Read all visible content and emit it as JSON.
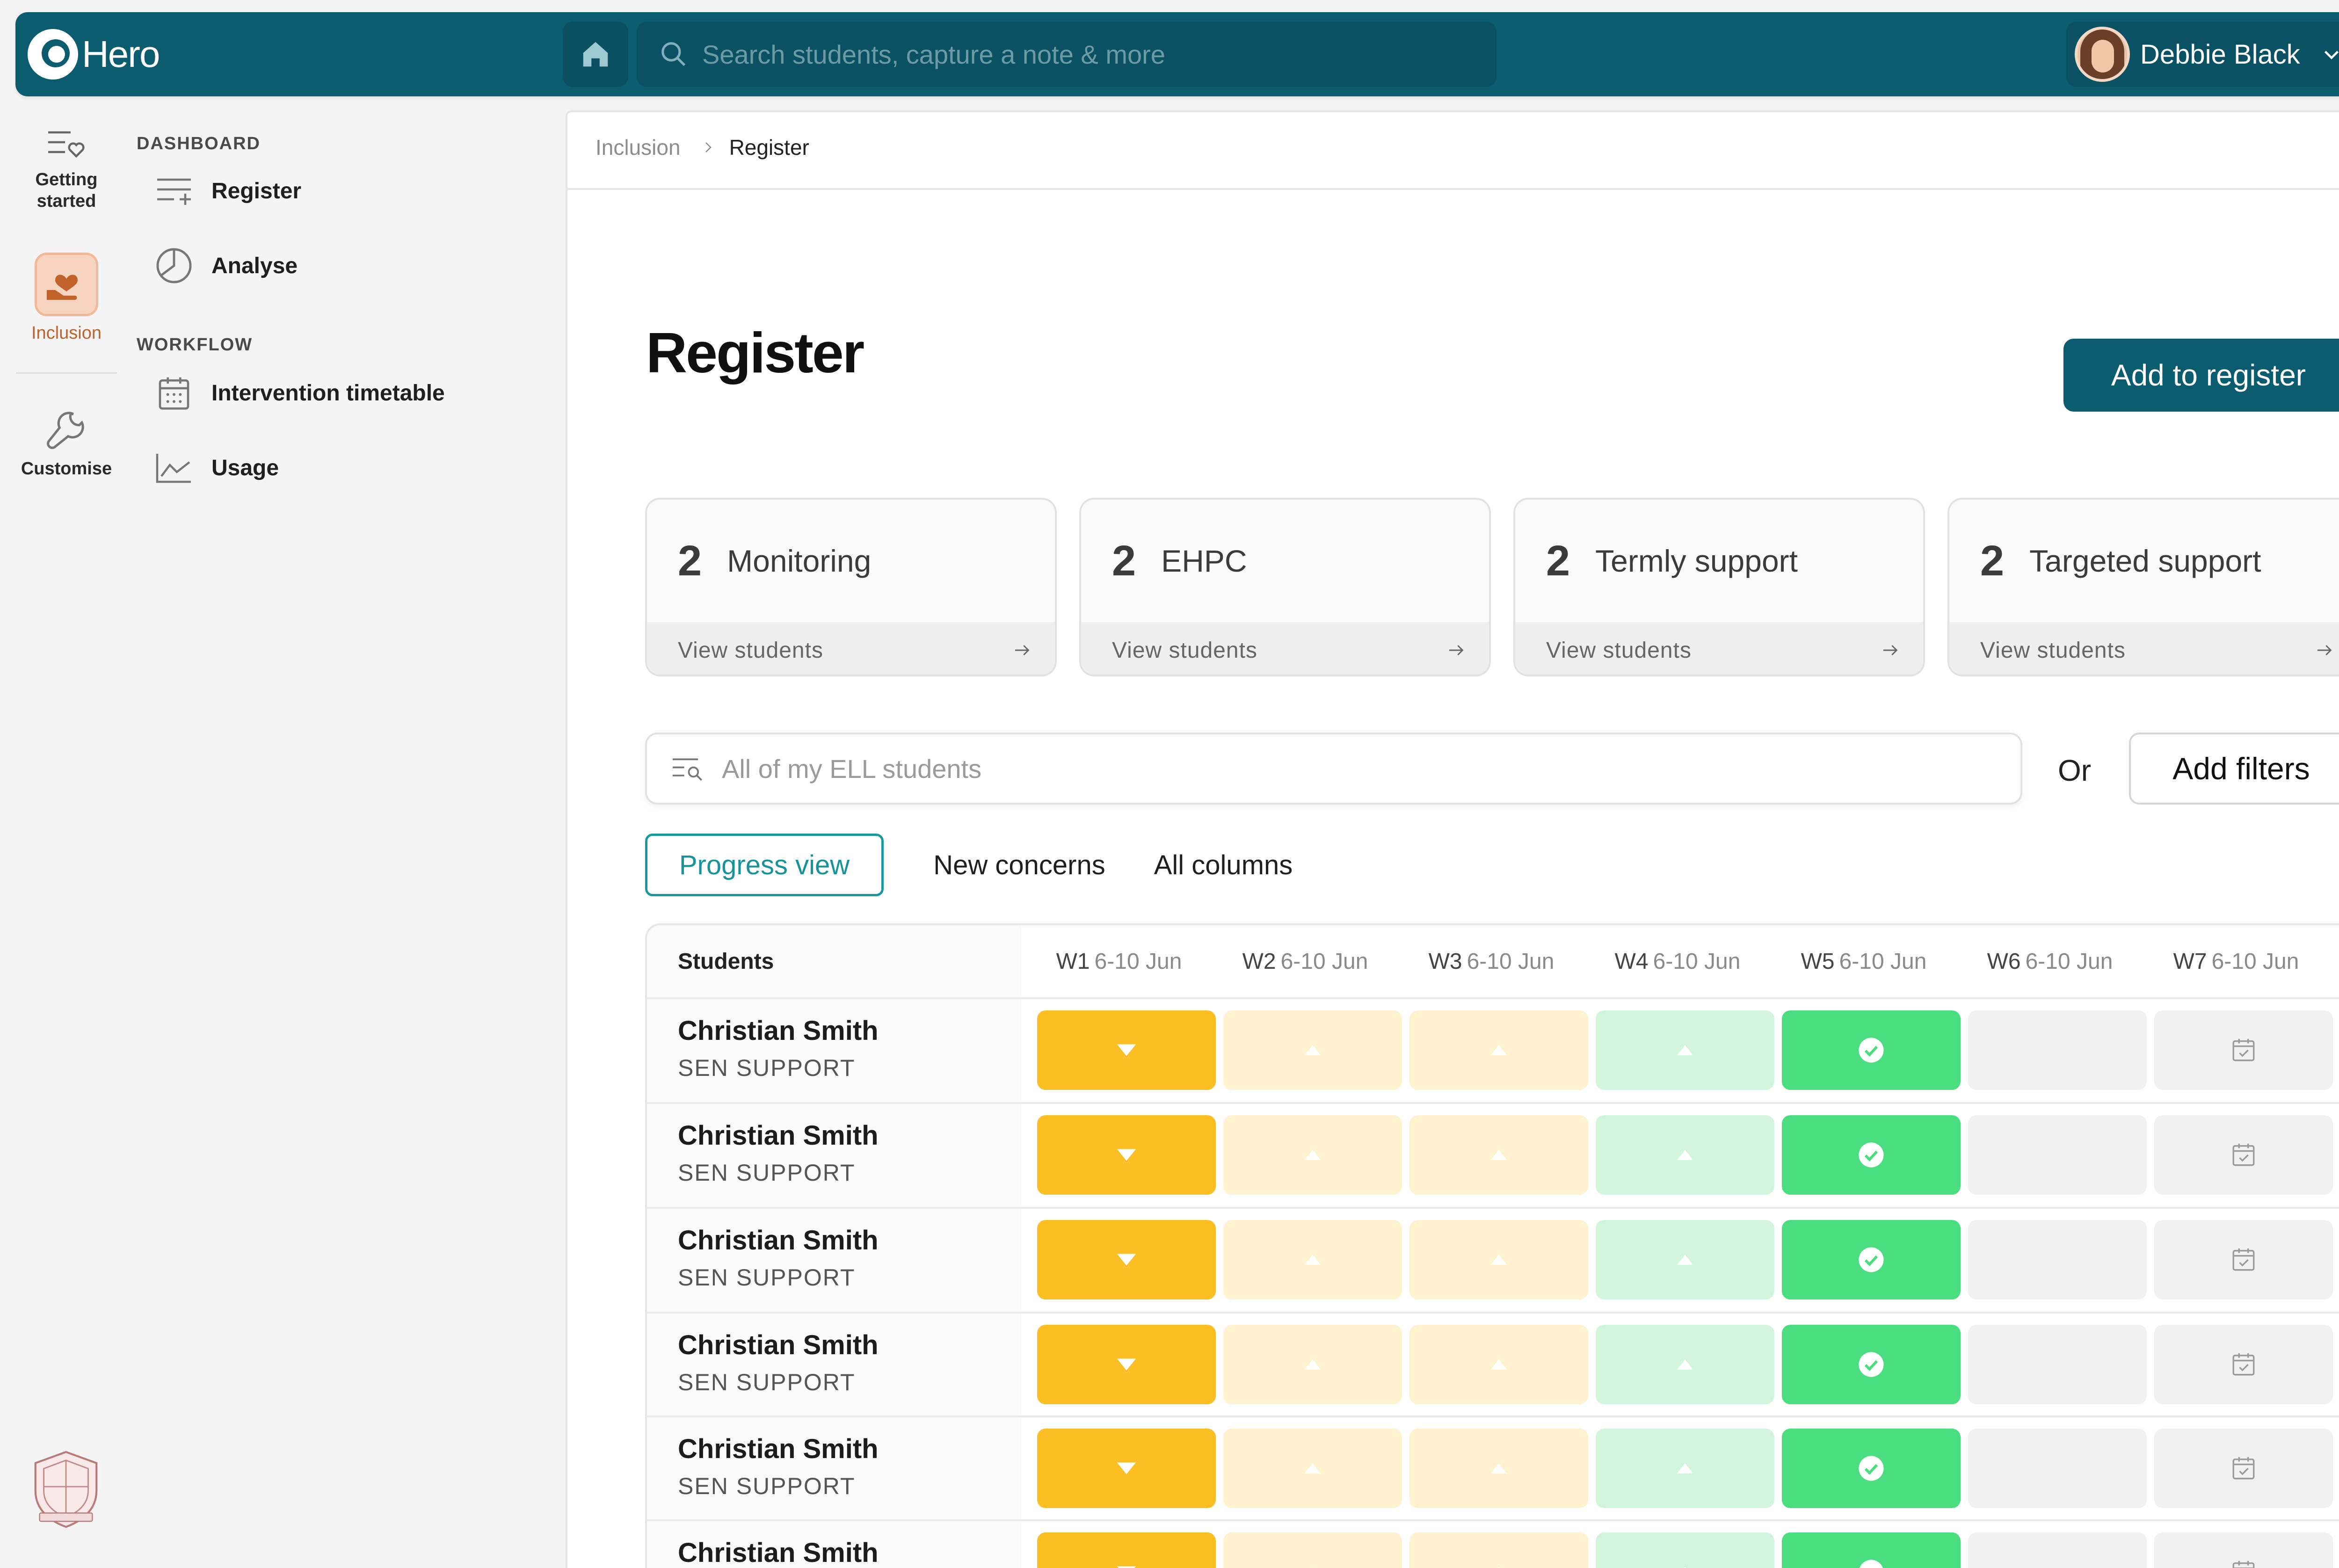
{
  "app": {
    "name": "Hero",
    "search_placeholder": "Search students, capture a note & more",
    "user_name": "Debbie Black"
  },
  "rail": {
    "getting_started": "Getting started",
    "inclusion": "Inclusion",
    "customise": "Customise"
  },
  "sidenav": {
    "dashboard_heading": "DASHBOARD",
    "register": "Register",
    "analyse": "Analyse",
    "workflow_heading": "WORKFLOW",
    "intervention_timetable": "Intervention timetable",
    "usage": "Usage"
  },
  "breadcrumb": {
    "parent": "Inclusion",
    "current": "Register"
  },
  "page": {
    "title": "Register",
    "add_button": "Add to register"
  },
  "stats": [
    {
      "count": "2",
      "label": "Monitoring",
      "link": "View students"
    },
    {
      "count": "2",
      "label": "EHPC",
      "link": "View students"
    },
    {
      "count": "2",
      "label": "Termly support",
      "link": "View students"
    },
    {
      "count": "2",
      "label": "Targeted support",
      "link": "View students"
    }
  ],
  "filter": {
    "placeholder": "All of my ELL students",
    "or_text": "Or",
    "add_filters": "Add filters"
  },
  "tabs": [
    "Progress view",
    "New concerns",
    "All columns"
  ],
  "table": {
    "student_header": "Students",
    "weeks": [
      {
        "week": "W1",
        "dates": "6-10 Jun"
      },
      {
        "week": "W2",
        "dates": "6-10 Jun"
      },
      {
        "week": "W3",
        "dates": "6-10 Jun"
      },
      {
        "week": "W4",
        "dates": "6-10 Jun"
      },
      {
        "week": "W5",
        "dates": "6-10 Jun"
      },
      {
        "week": "W6",
        "dates": "6-10 Jun"
      },
      {
        "week": "W7",
        "dates": "6-10 Jun"
      }
    ],
    "rows": [
      {
        "name": "Christian Smith",
        "status": "SEN SUPPORT"
      },
      {
        "name": "Christian Smith",
        "status": "SEN SUPPORT"
      },
      {
        "name": "Christian Smith",
        "status": "SEN SUPPORT"
      },
      {
        "name": "Christian Smith",
        "status": "SEN SUPPORT"
      },
      {
        "name": "Christian Smith",
        "status": "SEN SUPPORT"
      },
      {
        "name": "Christian Smith",
        "status": "SEN SUPPORT"
      }
    ],
    "cell_states": [
      "down",
      "up-light",
      "up-light",
      "up-green-light",
      "check",
      "empty",
      "calendar"
    ]
  },
  "colors": {
    "brand": "#0c5c70",
    "accent": "#1a98a0",
    "down": "#fbbf24",
    "up_light": "#fef2cf",
    "green_light": "#d2f4dd",
    "green": "#4ade80"
  }
}
